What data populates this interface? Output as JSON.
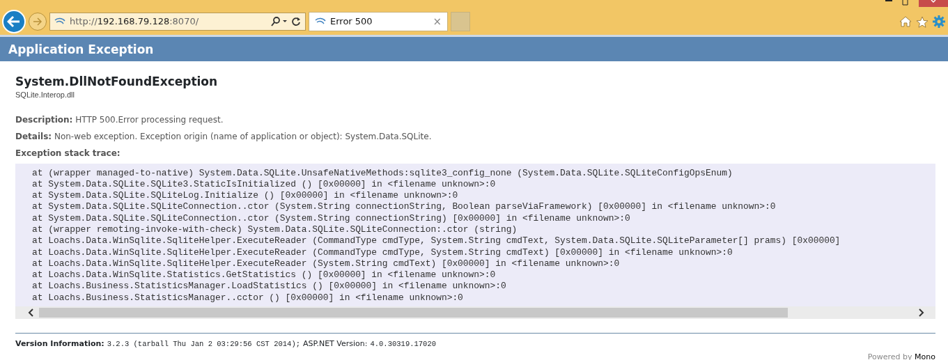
{
  "browser": {
    "address": {
      "scheme": "http://",
      "host": "192.168.79.128",
      "port": ":8070/"
    },
    "tabs": [
      {
        "label": "Error 500",
        "close": "×",
        "selected": true
      }
    ]
  },
  "header": {
    "title": "Application Exception"
  },
  "exception": {
    "name": "System.DllNotFoundException",
    "message": "SQLite.Interop.dll"
  },
  "fields": [
    {
      "label": "Description:",
      "value": "HTTP 500.Error processing request."
    },
    {
      "label": "Details:",
      "value": "Non-web exception. Exception origin (name of application or object): System.Data.SQLite."
    }
  ],
  "stack_trace": {
    "heading": "Exception stack trace:",
    "lines": [
      "at (wrapper managed-to-native) System.Data.SQLite.UnsafeNativeMethods:sqlite3_config_none (System.Data.SQLite.SQLiteConfigOpsEnum)",
      "at System.Data.SQLite.SQLite3.StaticIsInitialized () [0x00000] in <filename unknown>:0",
      "at System.Data.SQLite.SQLiteLog.Initialize () [0x00000] in <filename unknown>:0",
      "at System.Data.SQLite.SQLiteConnection..ctor (System.String connectionString, Boolean parseViaFramework) [0x00000] in <filename unknown>:0",
      "at System.Data.SQLite.SQLiteConnection..ctor (System.String connectionString) [0x00000] in <filename unknown>:0",
      "at (wrapper remoting-invoke-with-check) System.Data.SQLite.SQLiteConnection:.ctor (string)",
      "at Loachs.Data.WinSqlite.SqliteHelper.ExecuteReader (CommandType cmdType, System.String cmdText, System.Data.SQLite.SQLiteParameter[] prams) [0x00000]",
      "at Loachs.Data.WinSqlite.SqliteHelper.ExecuteReader (CommandType cmdType, System.String cmdText) [0x00000] in <filename unknown>:0",
      "at Loachs.Data.WinSqlite.SqliteHelper.ExecuteReader (System.String cmdText) [0x00000] in <filename unknown>:0",
      "at Loachs.Data.WinSqlite.Statistics.GetStatistics () [0x00000] in <filename unknown>:0",
      "at Loachs.Business.StatisticsManager.LoadStatistics () [0x00000] in <filename unknown>:0",
      "at Loachs.Business.StatisticsManager..cctor () [0x00000] in <filename unknown>:0"
    ]
  },
  "version": {
    "label": "Version Information:",
    "mono_version": "3.2.3 (tarball Thu Jan 2 03:29:56 CST 2014);",
    "aspnet_label": "ASP.NET Version:",
    "aspnet_version": "4.0.30319.17020"
  },
  "footer": {
    "powered_by": "Powered by",
    "link": "Mono"
  }
}
